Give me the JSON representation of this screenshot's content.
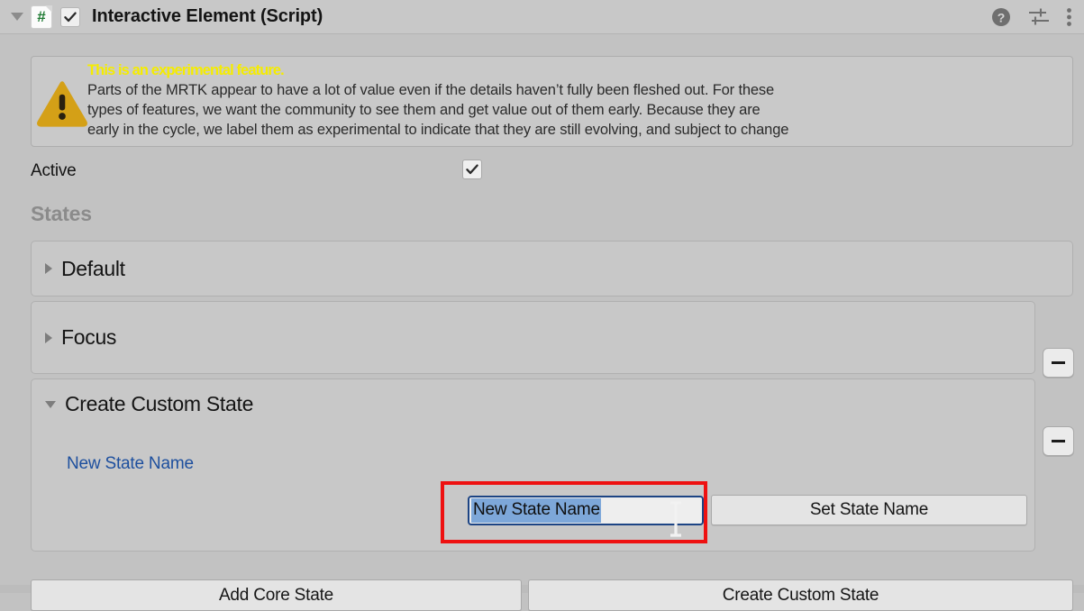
{
  "header": {
    "title": "Interactive Element (Script)",
    "foldout_icon": "triangle-down-icon",
    "script_icon": "script-hash-icon",
    "script_icon_glyph": "#",
    "enabled_checkbox": true,
    "help_icon": "help-icon",
    "preset_icon": "preset-sliders-icon",
    "menu_icon": "kebab-menu-icon"
  },
  "warning": {
    "icon": "warning-triangle-icon",
    "title": "This is an experimental feature.",
    "body": "Parts of the MRTK appear to have a lot of value even if the details haven’t fully been fleshed out. For these\ntypes of features, we want the community to see them and get value out of them early. Because they are\nearly in the cycle, we label them as experimental to indicate that they are still evolving, and subject to change",
    "title_color": "#f5ec00",
    "icon_color": "#d4a017"
  },
  "active": {
    "label": "Active",
    "checked": true
  },
  "states": {
    "heading": "States",
    "items": [
      {
        "label": "Default",
        "expanded": false,
        "removable": false
      },
      {
        "label": "Focus",
        "expanded": false,
        "removable": true
      },
      {
        "label": "Create Custom State",
        "expanded": true,
        "removable": true
      }
    ],
    "remove_button_label": "–"
  },
  "custom_state": {
    "field_label": "New State Name",
    "field_value": "New State Name",
    "field_placeholder": "New State Name",
    "field_selected": true,
    "set_button_label": "Set State Name",
    "annotation_color": "#ee1111",
    "selection_color": "#7da7d9",
    "focus_border_color": "#1c4484",
    "label_color": "#1d4f9e"
  },
  "footer": {
    "add_core_state_label": "Add Core State",
    "create_custom_state_label": "Create Custom State"
  }
}
